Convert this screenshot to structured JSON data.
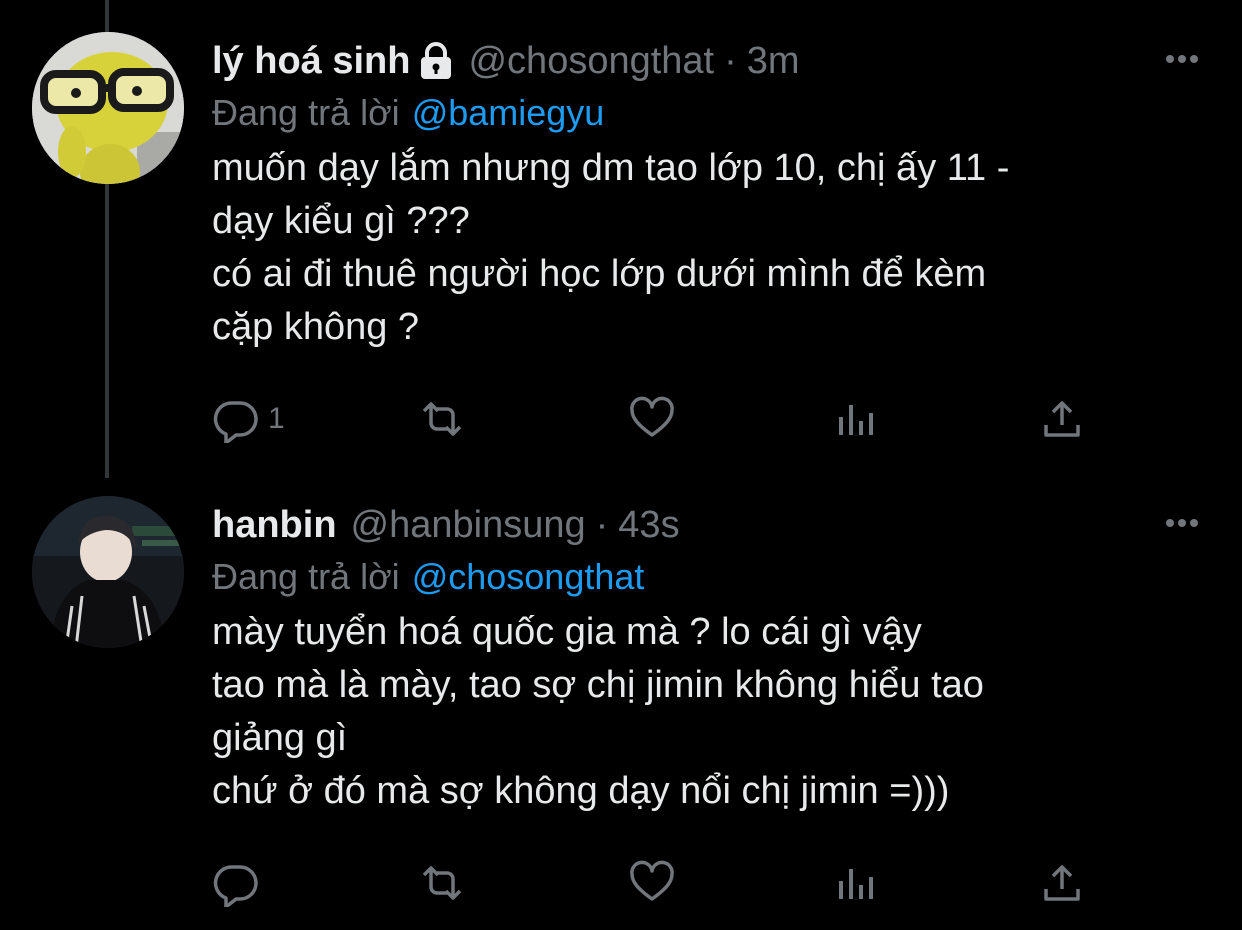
{
  "tweets": [
    {
      "display_name": "lý hoá sinh",
      "handle": "@chosongthat",
      "separator": "·",
      "time": "3m",
      "replying_prefix": "Đang trả lời",
      "replying_to": "@bamiegyu",
      "body_lines": [
        "muốn dạy lắm nhưng dm tao lớp 10, chị ấy 11 -",
        "dạy kiểu gì ???",
        "có ai đi thuê người học lớp dưới mình để kèm",
        "cặp không ?"
      ],
      "reply_count": "1",
      "locked": true
    },
    {
      "display_name": "hanbin",
      "handle": "@hanbinsung",
      "separator": "·",
      "time": "43s",
      "replying_prefix": "Đang trả lời",
      "replying_to": "@chosongthat",
      "body_lines": [
        "mày tuyển hoá quốc gia mà ? lo cái gì vậy",
        "tao mà là mày, tao sợ chị jimin không hiểu tao",
        "giảng gì",
        "chứ ở đó mà sợ không dạy nổi chị jimin =)))"
      ],
      "reply_count": ""
    }
  ],
  "icons": {
    "action_icons": [
      "reply-icon",
      "retweet-icon",
      "like-icon",
      "views-icon",
      "share-icon"
    ],
    "more": "more-options-icon",
    "lock": "lock-icon"
  },
  "colors": {
    "background": "#000000",
    "text": "#e7e9ea",
    "secondary": "#71767b",
    "accent": "#1d9bf0"
  }
}
